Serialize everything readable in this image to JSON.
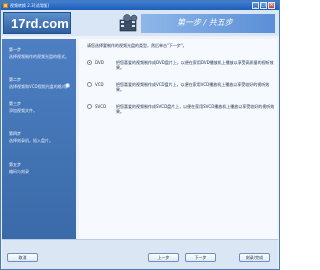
{
  "window": {
    "title": "视频转换 2.3[试用版]"
  },
  "banner": {
    "logo_text": "17rd.com",
    "step_title": "第一步 / 共五步"
  },
  "sidebar": {
    "steps": [
      {
        "label": "第一步",
        "desc": "选择视频制作的视频光盘的格式。"
      },
      {
        "label": "第二步",
        "desc": "选择视频和VCD视频光盘的格式。"
      },
      {
        "label": "第三步",
        "desc": "添加视频文件。"
      },
      {
        "label": "第四步",
        "desc": "选择刻录机，插入盘片。"
      },
      {
        "label": "第五步",
        "desc": "编码与刻录"
      }
    ]
  },
  "main": {
    "instruction": "请您选择要制作的视频光盘的类型，然后单击\"下一步\"。",
    "options": [
      {
        "name": "DVD",
        "checked": true,
        "desc": "把您喜爱的视频制作成DVD盘片上，以便在家用DVD播放机上播放以享受高质量的视听效果。"
      },
      {
        "name": "VCD",
        "checked": false,
        "desc": "把您喜爱的视频制作成VCD盘片上，以便在家用VCD播放机上播放以享受较好的视听效果。"
      },
      {
        "name": "SVCD",
        "checked": false,
        "desc": "把您喜爱的视频制作成SVCD盘片上，以便在家用SVCD播放机上播放以享受较好的视听效果。"
      }
    ]
  },
  "footer": {
    "cancel": "取消",
    "prev": "上一步",
    "next": "下一步",
    "finish": "刻录/完成"
  },
  "colors": {
    "titlebar": "#2f6cc4",
    "sidebar": "#4577ba",
    "banner_step": "#7aa6df"
  },
  "icons": {
    "app": "app-icon",
    "film": "film-reel-icon",
    "minimize": "minimize-icon",
    "maximize": "maximize-icon",
    "close": "close-icon"
  }
}
